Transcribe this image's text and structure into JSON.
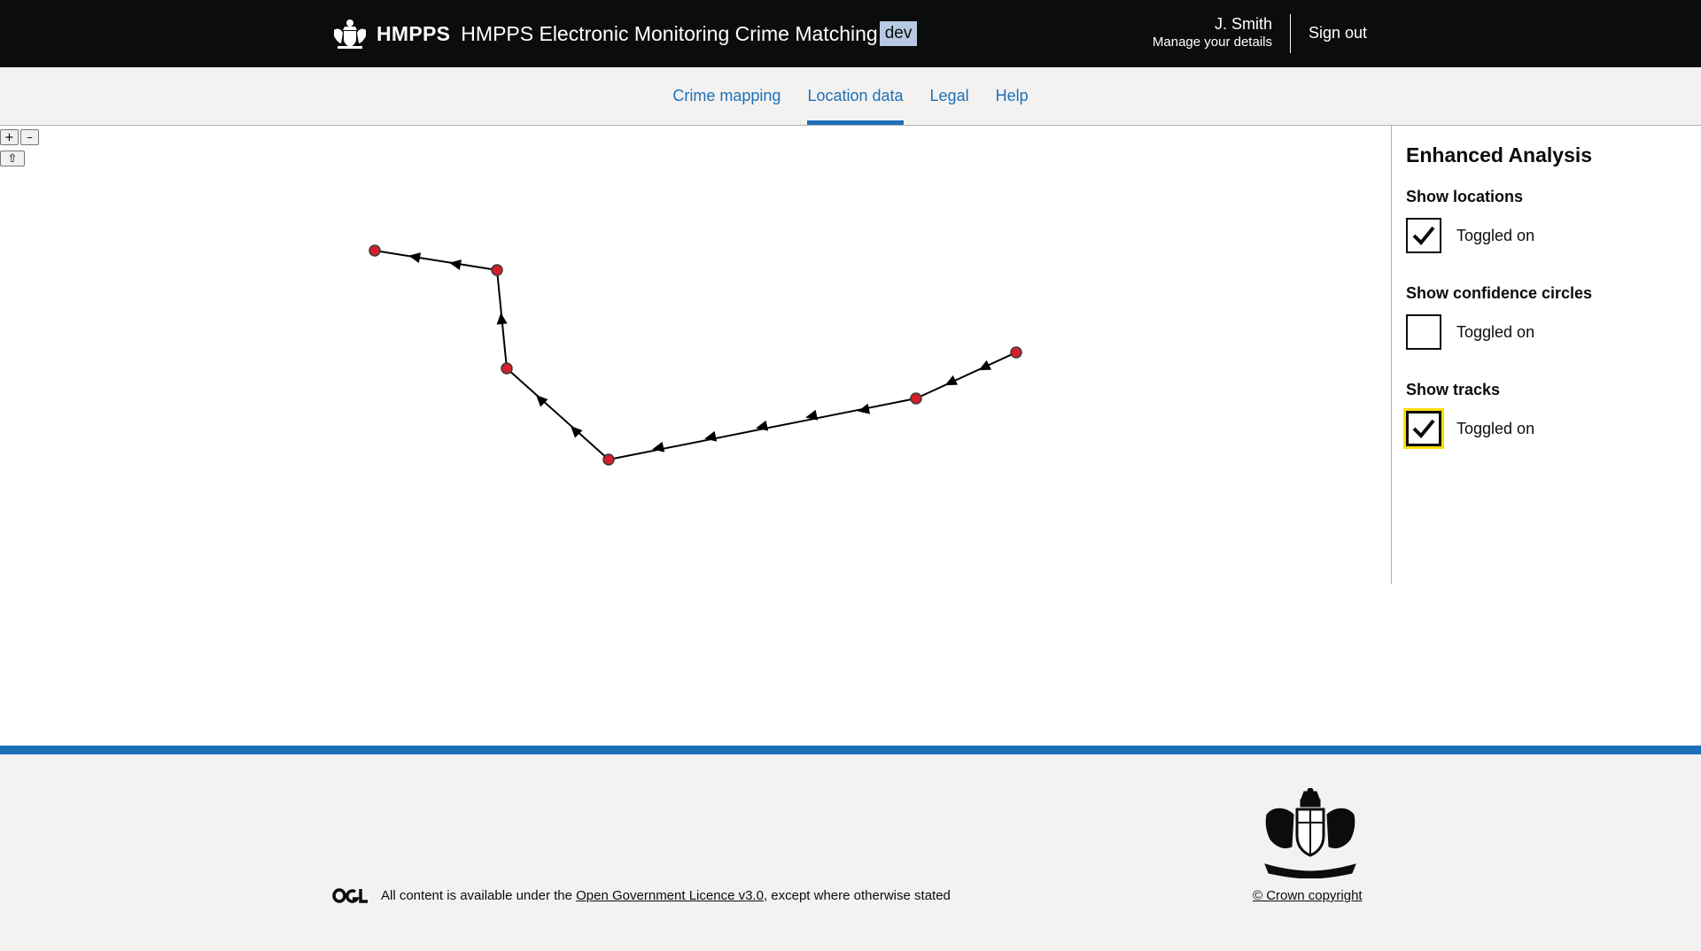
{
  "header": {
    "org_name": "HMPPS",
    "service_name": "HMPPS Electronic Monitoring Crime Matching",
    "env_tag": "dev",
    "user_name": "J. Smith",
    "manage_details": "Manage your details",
    "sign_out": "Sign out"
  },
  "nav": {
    "items": [
      {
        "label": "Crime mapping",
        "active": false
      },
      {
        "label": "Location data",
        "active": true
      },
      {
        "label": "Legal",
        "active": false
      },
      {
        "label": "Help",
        "active": false
      }
    ]
  },
  "map": {
    "controls": {
      "zoom_in": "+",
      "zoom_out": "–",
      "home": "⇧"
    },
    "track_color": "#000000",
    "marker_color": "#d4202a"
  },
  "panel": {
    "title": "Enhanced Analysis",
    "toggles": [
      {
        "label": "Show locations",
        "state_text": "Toggled on",
        "checked": true
      },
      {
        "label": "Show confidence circles",
        "state_text": "Toggled on",
        "checked": false
      },
      {
        "label": "Show tracks",
        "state_text": "Toggled on",
        "checked": true
      }
    ]
  },
  "footer": {
    "licence_prefix": "All content is available under the ",
    "licence_link": "Open Government Licence v3.0",
    "licence_suffix": ", except where otherwise stated",
    "copyright": "© Crown copyright",
    "accent_color": "#1d70b8"
  }
}
